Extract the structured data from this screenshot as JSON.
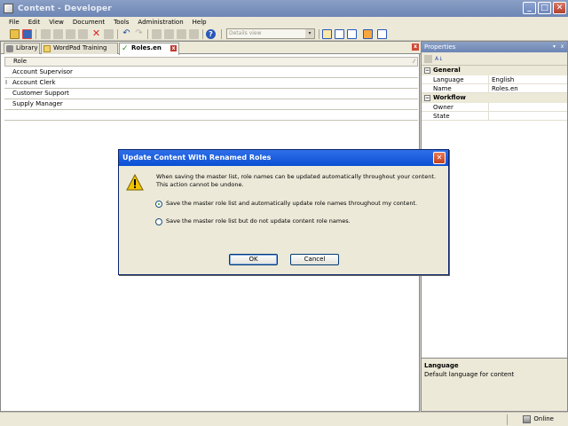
{
  "window": {
    "title": "Content - Developer",
    "min_label": "_",
    "max_label": "□",
    "close_label": "✕"
  },
  "menu": [
    "File",
    "Edit",
    "View",
    "Document",
    "Tools",
    "Administration",
    "Help"
  ],
  "toolbar": {
    "view_select": "Details view",
    "view_arrow": "▾"
  },
  "tabs": [
    {
      "label": "Library",
      "icon": "library-icon"
    },
    {
      "label": "WordPad Training",
      "icon": "wordpad-icon"
    },
    {
      "label": "Roles.en",
      "icon": "roles-check-icon",
      "active": true
    }
  ],
  "tab_close": "x",
  "area_close": "x",
  "grid": {
    "header": "Role",
    "header_pin": "⁄",
    "cursor": "I",
    "rows": [
      "Account Supervisor",
      "Account Clerk",
      "Customer Support",
      "Supply Manager",
      ""
    ]
  },
  "properties": {
    "title": "Properties",
    "pin": "▾",
    "close": "x",
    "sort_icon": "A↓",
    "categories": [
      {
        "name": "General",
        "toggle": "−",
        "props": [
          {
            "name": "Language",
            "value": "English"
          },
          {
            "name": "Name",
            "value": "Roles.en"
          }
        ]
      },
      {
        "name": "Workflow",
        "toggle": "−",
        "props": [
          {
            "name": "Owner",
            "value": ""
          },
          {
            "name": "State",
            "value": ""
          }
        ]
      }
    ],
    "desc_title": "Language",
    "desc_text": "Default language for content"
  },
  "status": {
    "online": "Online"
  },
  "dialog": {
    "title": "Update Content With Renamed Roles",
    "close": "✕",
    "message": "When saving the master list, role names can be updated automatically throughout your content.  This action cannot be undone.",
    "options": [
      {
        "label": "Save the master role list and automatically update role names throughout my content.",
        "checked": true
      },
      {
        "label": "Save the master role list but do not update content role names.",
        "checked": false
      }
    ],
    "ok": "OK",
    "cancel": "Cancel"
  },
  "colors": {
    "title_active": "#0a4fd3",
    "title_inactive": "#7d93be",
    "warning": "#f2c400",
    "close_red": "#c23e1e"
  }
}
